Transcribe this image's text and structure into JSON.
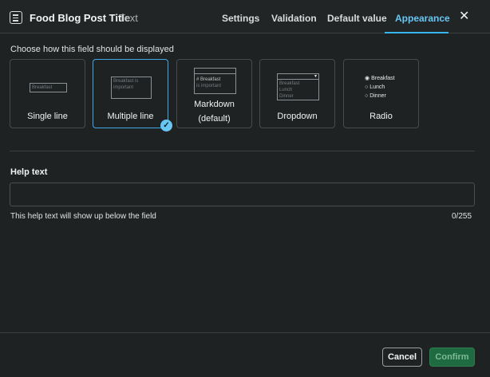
{
  "header": {
    "title": "Food Blog Post Title",
    "subtitle": "Text",
    "icon": "field-list-icon",
    "tabs": [
      {
        "label": "Settings",
        "active": false
      },
      {
        "label": "Validation",
        "active": false
      },
      {
        "label": "Default value",
        "active": false
      },
      {
        "label": "Appearance",
        "active": true
      }
    ],
    "close_icon": "close-icon"
  },
  "appearance": {
    "section_label": "Choose how this field should be displayed",
    "options": [
      {
        "label": "Single line",
        "preview": [
          "Breakfast"
        ]
      },
      {
        "label": "Multiple line",
        "selected": true,
        "preview": [
          "Breakfast is",
          "important"
        ]
      },
      {
        "label_line1": "Markdown",
        "label_line2": "(default)",
        "preview": [
          "# Breakfast",
          "is important"
        ]
      },
      {
        "label": "Dropdown",
        "preview": [
          "Breakfast",
          "Lunch",
          "Dinner"
        ]
      },
      {
        "label": "Radio",
        "preview": [
          "Breakfast",
          "Lunch",
          "Dinner"
        ]
      }
    ]
  },
  "help": {
    "title": "Help text",
    "value": "",
    "hint": "This help text will show up below the field",
    "counter": "0/255"
  },
  "footer": {
    "cancel_label": "Cancel",
    "confirm_label": "Confirm"
  },
  "colors": {
    "accent": "#38b5ec",
    "confirm": "#1e6a41",
    "background": "#1f2223"
  }
}
